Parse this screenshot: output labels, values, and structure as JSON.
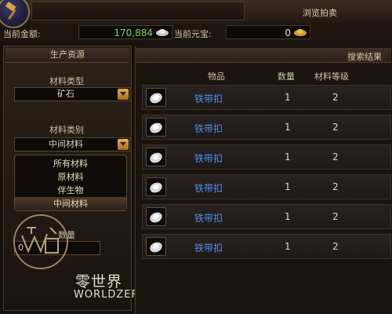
{
  "header": {
    "title": "浏览拍卖"
  },
  "currency": {
    "gold_label": "当前金额:",
    "gold_value": "170,884",
    "yuanbao_label": "当前元宝:",
    "yuanbao_value": "0"
  },
  "left_panel": {
    "title": "生产资源",
    "material_type_label": "材料类型",
    "material_type_value": "矿石",
    "material_category_label": "材料类别",
    "material_category_value": "中间材料",
    "category_options": [
      "所有材料",
      "原材料",
      "伴生物",
      "中间材料"
    ],
    "quantity_label": "数量",
    "quantity_value": "0"
  },
  "logo": {
    "main_text": "零世界",
    "sub_text": "WORLDZERO"
  },
  "results": {
    "title": "搜索结果",
    "columns": [
      "物品",
      "数量",
      "材料等级"
    ],
    "rows": [
      {
        "name": "铁带扣",
        "quantity": "1",
        "level": "2"
      },
      {
        "name": "铁带扣",
        "quantity": "1",
        "level": "2"
      },
      {
        "name": "铁带扣",
        "quantity": "1",
        "level": "2"
      },
      {
        "name": "铁带扣",
        "quantity": "1",
        "level": "2"
      },
      {
        "name": "铁带扣",
        "quantity": "1",
        "level": "2"
      },
      {
        "name": "铁带扣",
        "quantity": "1",
        "level": "2"
      }
    ]
  },
  "icons": {
    "badge": "gavel-icon",
    "silver": "silver-ingot-icon",
    "gold": "gold-ingot-icon",
    "item": "iron-buckle-icon"
  }
}
